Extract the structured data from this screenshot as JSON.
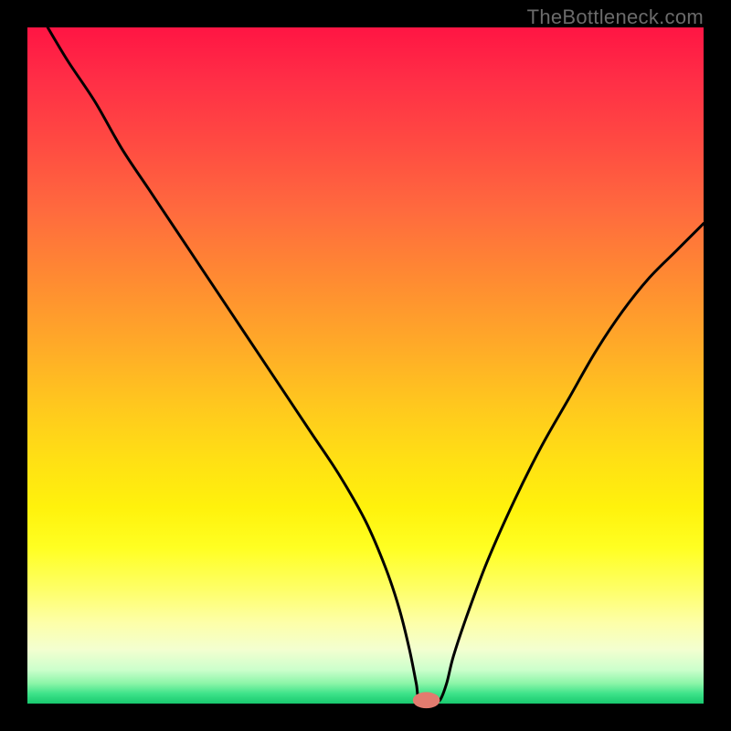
{
  "watermark": {
    "text": "TheBottleneck.com"
  },
  "colors": {
    "frame": "#000000",
    "curve": "#000000",
    "marker_fill": "#e27b6f",
    "gradient_top": "#ff1544",
    "gradient_bottom": "#18c96e"
  },
  "chart_data": {
    "type": "line",
    "title": "",
    "xlabel": "",
    "ylabel": "",
    "xlim": [
      0,
      100
    ],
    "ylim": [
      0,
      100
    ],
    "grid": false,
    "x": [
      3,
      6,
      10,
      14,
      18,
      22,
      26,
      30,
      34,
      38,
      42,
      46,
      50,
      53,
      55,
      56.5,
      57.5,
      58,
      60,
      61,
      62,
      63,
      65,
      68,
      72,
      76,
      80,
      84,
      88,
      92,
      96,
      100
    ],
    "values": [
      100,
      95,
      89,
      82,
      76,
      70,
      64,
      58,
      52,
      46,
      40,
      34,
      27,
      20,
      14,
      8,
      3,
      0.5,
      0.5,
      0.5,
      3,
      7,
      13,
      21,
      30,
      38,
      45,
      52,
      58,
      63,
      67,
      71
    ],
    "series": [
      {
        "name": "bottleneck-curve",
        "x": [
          3,
          6,
          10,
          14,
          18,
          22,
          26,
          30,
          34,
          38,
          42,
          46,
          50,
          53,
          55,
          56.5,
          57.5,
          58,
          60,
          61,
          62,
          63,
          65,
          68,
          72,
          76,
          80,
          84,
          88,
          92,
          96,
          100
        ],
        "y": [
          100,
          95,
          89,
          82,
          76,
          70,
          64,
          58,
          52,
          46,
          40,
          34,
          27,
          20,
          14,
          8,
          3,
          0.5,
          0.5,
          0.5,
          3,
          7,
          13,
          21,
          30,
          38,
          45,
          52,
          58,
          63,
          67,
          71
        ]
      }
    ],
    "marker": {
      "x": 59,
      "y": 0.5,
      "rx": 2.0,
      "ry": 1.2
    },
    "annotations": []
  }
}
